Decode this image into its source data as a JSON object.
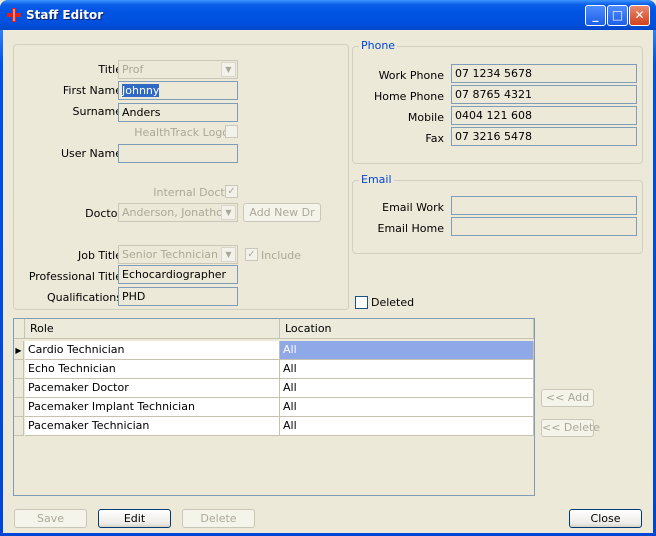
{
  "window": {
    "title": "Staff Editor"
  },
  "colors": {
    "title_bar": "#0054e3",
    "selection": "#8fa8e8",
    "accent": "#0046d5"
  },
  "details": {
    "title_label": "Title",
    "title_value": "Prof",
    "first_name_label": "First Name",
    "first_name_value": "Johnny",
    "surname_label": "Surname",
    "surname_value": "Anders",
    "healthtrack_label": "HealthTrack Logon",
    "healthtrack_checked": false,
    "username_label": "User Name",
    "username_value": "",
    "internal_doctor_label": "Internal Doctor",
    "internal_doctor_checked": true,
    "doctor_label": "Doctor",
    "doctor_value": "Anderson, Jonathon",
    "add_new_dr_label": "Add New Dr",
    "job_title_label": "Job Title",
    "job_title_value": "Senior Technician",
    "include_label": "Include",
    "include_checked": true,
    "professional_title_label": "Professional Title",
    "professional_title_value": "Echocardiographer",
    "qualifications_label": "Qualifications",
    "qualifications_value": "PHD"
  },
  "phone": {
    "legend": "Phone",
    "work_label": "Work Phone",
    "work_value": "07 1234 5678",
    "home_label": "Home Phone",
    "home_value": "07 8765 4321",
    "mobile_label": "Mobile",
    "mobile_value": "0404 121 608",
    "fax_label": "Fax",
    "fax_value": "07 3216 5478"
  },
  "email": {
    "legend": "Email",
    "work_label": "Email Work",
    "work_value": "",
    "home_label": "Email Home",
    "home_value": ""
  },
  "deleted": {
    "label": "Deleted",
    "checked": false
  },
  "roles_grid": {
    "columns": [
      "Role",
      "Location"
    ],
    "rows": [
      {
        "role": "Cardio Technician",
        "location": "All"
      },
      {
        "role": "Echo Technician",
        "location": "All"
      },
      {
        "role": "Pacemaker Doctor",
        "location": "All"
      },
      {
        "role": "Pacemaker Implant Technician",
        "location": "All"
      },
      {
        "role": "Pacemaker Technician",
        "location": "All"
      }
    ]
  },
  "side_buttons": {
    "add": "<< Add",
    "delete": "<< Delete"
  },
  "footer": {
    "save": "Save",
    "edit": "Edit",
    "delete": "Delete",
    "close": "Close"
  }
}
